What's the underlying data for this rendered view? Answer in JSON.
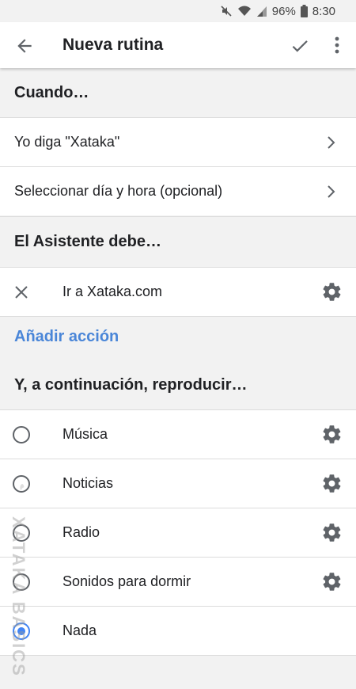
{
  "status_bar": {
    "battery": "96%",
    "time": "8:30"
  },
  "app_bar": {
    "title": "Nueva rutina"
  },
  "when": {
    "header": "Cuando…",
    "items": [
      {
        "label": "Yo diga \"Xataka\""
      },
      {
        "label": "Seleccionar día y hora (opcional)"
      }
    ]
  },
  "assistant": {
    "header": "El Asistente debe…",
    "actions": [
      {
        "label": "Ir a Xataka.com"
      }
    ],
    "add_action_label": "Añadir acción"
  },
  "then": {
    "header": "Y, a continuación, reproducir…",
    "options": [
      {
        "label": "Música",
        "selected": false,
        "has_settings": true
      },
      {
        "label": "Noticias",
        "selected": false,
        "has_settings": true
      },
      {
        "label": "Radio",
        "selected": false,
        "has_settings": true
      },
      {
        "label": "Sonidos para dormir",
        "selected": false,
        "has_settings": true
      },
      {
        "label": "Nada",
        "selected": true,
        "has_settings": false
      }
    ]
  },
  "watermark": {
    "text": "XATAKA BASICS"
  },
  "colors": {
    "accent": "#4285f4",
    "link": "#4a86d8",
    "background": "#f2f2f2"
  }
}
